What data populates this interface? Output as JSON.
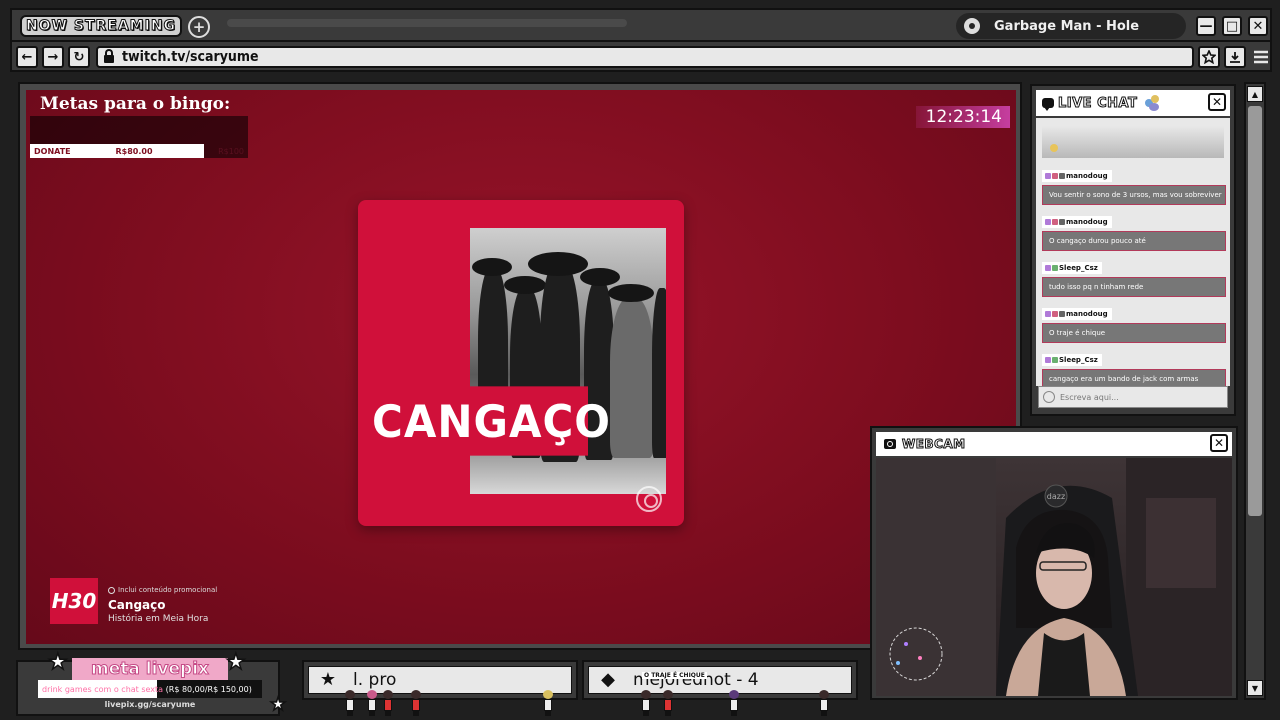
{
  "browser": {
    "streaming_tab_label": "NOW STREAMING",
    "new_tab_symbol": "+",
    "now_playing": "Garbage Man - Hole",
    "url": "twitch.tv/scaryume",
    "window_controls": {
      "minimize": "—",
      "maximize": "□",
      "close": "✕"
    },
    "nav": {
      "back": "←",
      "forward": "→",
      "reload": "↻"
    },
    "toolbar_icons": [
      "star-icon",
      "download-icon",
      "menu-icon"
    ]
  },
  "stream": {
    "bingo_title": "Metas para o bingo:",
    "goal_active": {
      "name": "DONATE",
      "value": "R$80.00",
      "max": "R$100"
    },
    "clock": "12:23:14",
    "card_title": "CANGAÇO",
    "show": {
      "logo": "H30",
      "promo_notice": "Inclui conteúdo promocional",
      "episode_title": "Cangaço",
      "show_name": "História em Meia Hora"
    }
  },
  "chat": {
    "title": "LIVE CHAT",
    "close": "✕",
    "input_placeholder": "Escreva aqui...",
    "messages": [
      {
        "user": "manodoug",
        "text": "Vou sentir o sono de 3 ursos, mas vou sobreviver"
      },
      {
        "user": "manodoug",
        "text": "O cangaço durou pouco até"
      },
      {
        "user": "Sleep_Csz",
        "text": "tudo isso pq n tinham rede"
      },
      {
        "user": "manodoug",
        "text": "O traje é chique"
      },
      {
        "user": "Sleep_Csz",
        "text": "cangaço era um bando de jack com armas"
      }
    ]
  },
  "webcam": {
    "title": "WEBCAM",
    "close": "✕",
    "chair_brand": "dazz"
  },
  "livepix": {
    "title": "meta livepix",
    "goal_text": "drink games com o chat sexta",
    "goal_amount": "(R$ 80,00/R$ 150,00)",
    "progress": 0.533,
    "url": "livepix.gg/scaryume"
  },
  "tickers": [
    {
      "icon": "star-icon",
      "text": "l. pro"
    },
    {
      "icon": "diamond-icon",
      "text": "mejoredhot - 4"
    }
  ],
  "crowd_tags": [
    "O TRAJE É CHIQUE"
  ],
  "scrollbar": {
    "up": "▲",
    "down": "▼"
  },
  "colors": {
    "stream_red": "#7e0d1f",
    "card_red": "#d0103a",
    "livepix_pink": "#f0a8c8",
    "clock_magenta": "#c63ea0"
  }
}
